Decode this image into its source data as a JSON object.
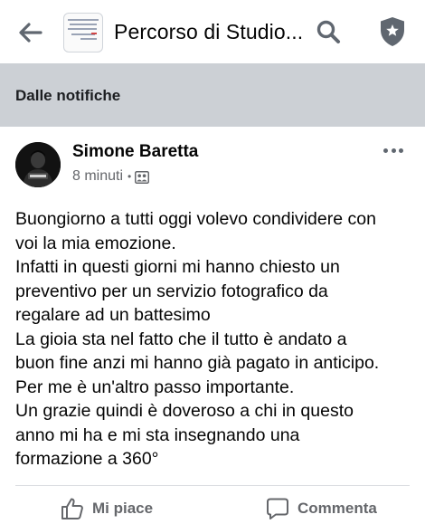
{
  "header": {
    "title": "Percorso di Studio...",
    "back_icon": "arrow-left-icon",
    "search_icon": "search-icon",
    "shield_icon": "shield-star-icon"
  },
  "notification_banner": {
    "label": "Dalle notifiche"
  },
  "post": {
    "author": "Simone Baretta",
    "time": "8 minuti",
    "separator": "•",
    "audience_icon": "group-members-icon",
    "more_icon": "more-options-icon",
    "body_lines": [
      "Buongiorno a tutti oggi volevo condividere con",
      "voi la mia emozione.",
      "Infatti in questi giorni mi hanno chiesto un",
      "preventivo per un servizio fotografico da",
      "regalare ad un battesimo",
      "La gioia sta nel fatto che il tutto è andato a",
      "buon fine anzi mi hanno già pagato in anticipo.",
      "Per me è un'altro passo importante.",
      "Un grazie quindi è doveroso a chi in questo",
      "anno mi ha e mi sta insegnando una",
      "formazione a 360°"
    ]
  },
  "actions": {
    "like_label": "Mi piace",
    "comment_label": "Commenta"
  },
  "colors": {
    "notif_bg": "#ccd0d5",
    "secondary_text": "#65676b",
    "icon_gray": "#606770"
  }
}
